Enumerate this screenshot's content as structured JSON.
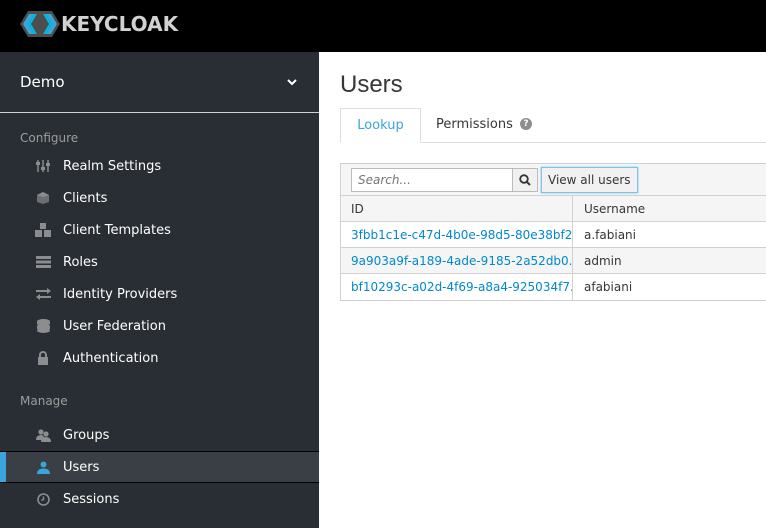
{
  "header": {
    "brand": "KEYCLOAK"
  },
  "sidebar": {
    "realm": "Demo",
    "sections": {
      "configure": "Configure",
      "manage": "Manage"
    },
    "configure_items": [
      {
        "label": "Realm Settings",
        "icon": "sliders-icon"
      },
      {
        "label": "Clients",
        "icon": "cube-icon"
      },
      {
        "label": "Client Templates",
        "icon": "cubes-icon"
      },
      {
        "label": "Roles",
        "icon": "server-icon"
      },
      {
        "label": "Identity Providers",
        "icon": "exchange-icon"
      },
      {
        "label": "User Federation",
        "icon": "database-icon"
      },
      {
        "label": "Authentication",
        "icon": "lock-icon"
      }
    ],
    "manage_items": [
      {
        "label": "Groups",
        "icon": "users-icon"
      },
      {
        "label": "Users",
        "icon": "user-icon",
        "active": true
      },
      {
        "label": "Sessions",
        "icon": "clock-icon"
      }
    ]
  },
  "main": {
    "title": "Users",
    "tabs": [
      {
        "label": "Lookup",
        "active": true
      },
      {
        "label": "Permissions",
        "help": "?"
      }
    ],
    "search": {
      "placeholder": "Search...",
      "value": ""
    },
    "view_all_label": "View all users",
    "columns": [
      "ID",
      "Username"
    ],
    "rows": [
      {
        "id": "3fbb1c1e-c47d-4b0e-98d5-80e38bf2...",
        "username": "a.fabiani"
      },
      {
        "id": "9a903a9f-a189-4ade-9185-2a52db0...",
        "username": "admin"
      },
      {
        "id": "bf10293c-a02d-4f69-a8a4-925034f7...",
        "username": "afabiani"
      }
    ]
  },
  "colors": {
    "accent": "#39a5dc",
    "link": "#0088ce",
    "sidebar_bg": "#292e34",
    "active_item_bg": "#393f44"
  }
}
